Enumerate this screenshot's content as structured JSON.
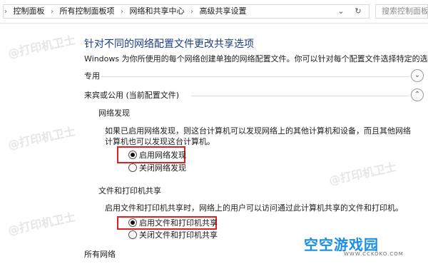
{
  "breadcrumb": {
    "items": [
      "控制面板",
      "所有控制面板项",
      "网络和共享中心",
      "高级共享设置"
    ],
    "separator": "›"
  },
  "address_buttons": {
    "dropdown": "⌄",
    "refresh": "↻"
  },
  "search": {
    "placeholder": "搜索控制面板"
  },
  "watermark": "@打印机卫士",
  "page": {
    "title": "针对不同的网络配置文件更改共享选项",
    "description": "Windows 为你所使用的每个网络创建单独的网络配置文件。你可以针对每个配置文件选择特定的选项。"
  },
  "profiles": {
    "private": {
      "label": "专用",
      "chevron": "⌄"
    },
    "guest": {
      "label": "来宾或公用 (当前配置文件)",
      "chevron": "⌃"
    },
    "all": {
      "label": "所有网络"
    }
  },
  "network_discovery": {
    "heading": "网络发现",
    "text": "如果已启用网络发现，则这台计算机可以发现网络上的其他计算机和设备，而且其他网络计算机也可以发现这台计算机。",
    "option_on": "启用网络发现",
    "option_off": "关闭网络发现",
    "selected": "on"
  },
  "file_printer_sharing": {
    "heading": "文件和打印机共享",
    "text": "启用文件和打印机共享时，网络上的用户可以访问通过此计算机共享的文件和打印机。",
    "option_on": "启用文件和打印机共享",
    "option_off": "关闭文件和打印机共享",
    "selected": "on"
  },
  "logo": {
    "main": "空空游戏园",
    "sub": "WWW.CCKOKO.COM"
  },
  "colors": {
    "title": "#1e3c8a",
    "highlight": "#e02020",
    "logo": "#1b8fe8"
  }
}
